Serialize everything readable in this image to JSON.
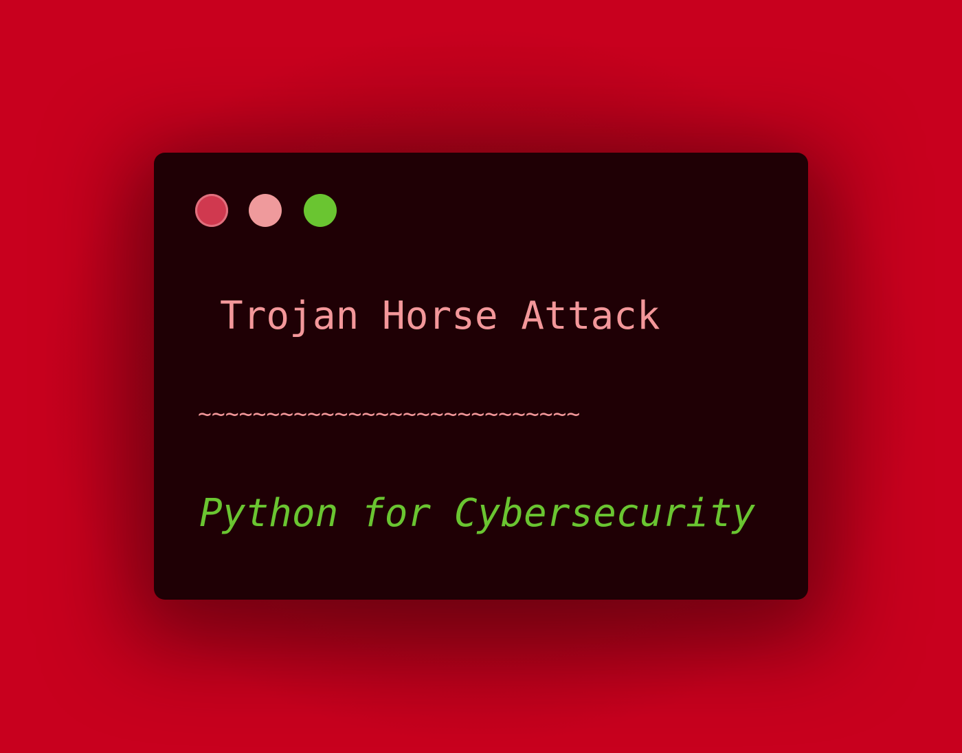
{
  "window": {
    "controls": {
      "close": {
        "icon": "close-dot-icon",
        "color": "#d0394f"
      },
      "minimize": {
        "icon": "minimize-dot-icon",
        "color": "#ef9a9c"
      },
      "maximize": {
        "icon": "maximize-dot-icon",
        "color": "#6ac531"
      }
    },
    "title": "Trojan Horse Attack",
    "divider": "~~~~~~~~~~~~~~~~~~~~~~~~~~~~",
    "subtitle": "Python for Cybersecurity"
  },
  "colors": {
    "background": "#c8001e",
    "window": "#1f0005",
    "title_text": "#f3979a",
    "subtitle_text": "#6ac531"
  }
}
